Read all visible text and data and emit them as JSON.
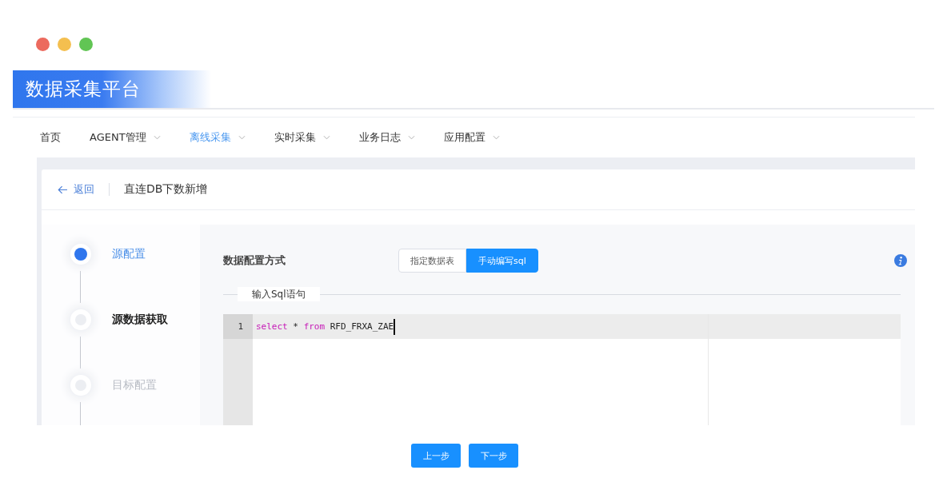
{
  "window": {
    "title": "数据采集平台"
  },
  "nav": [
    {
      "label": "首页",
      "selected": false,
      "dropdown": false
    },
    {
      "label": "AGENT管理",
      "selected": false,
      "dropdown": true
    },
    {
      "label": "离线采集",
      "selected": true,
      "dropdown": true
    },
    {
      "label": "实时采集",
      "selected": false,
      "dropdown": true
    },
    {
      "label": "业务日志",
      "selected": false,
      "dropdown": true
    },
    {
      "label": "应用配置",
      "selected": false,
      "dropdown": true
    }
  ],
  "page_header": {
    "back": "返回",
    "title": "直连DB下数新增"
  },
  "steps": [
    {
      "label": "源配置",
      "completed": true,
      "current": false
    },
    {
      "label": "源数据获取",
      "completed": false,
      "current": true
    },
    {
      "label": "目标配置",
      "completed": false,
      "current": false
    }
  ],
  "config": {
    "label": "数据配置方式",
    "options": [
      {
        "label": "指定数据表",
        "selected": false
      },
      {
        "label": "手动编写sql",
        "selected": true
      }
    ]
  },
  "sql_section": {
    "legend": "输入Sql语句",
    "lines": [
      {
        "number": "1",
        "tokens": [
          {
            "kind": "keyword",
            "text": "select"
          },
          {
            "kind": "plain",
            "text": " * "
          },
          {
            "kind": "keyword",
            "text": "from"
          },
          {
            "kind": "plain",
            "text": " RFD_FRXA_ZAE"
          }
        ]
      }
    ]
  },
  "footer": {
    "buttons": [
      "上一步",
      "下一步"
    ]
  }
}
